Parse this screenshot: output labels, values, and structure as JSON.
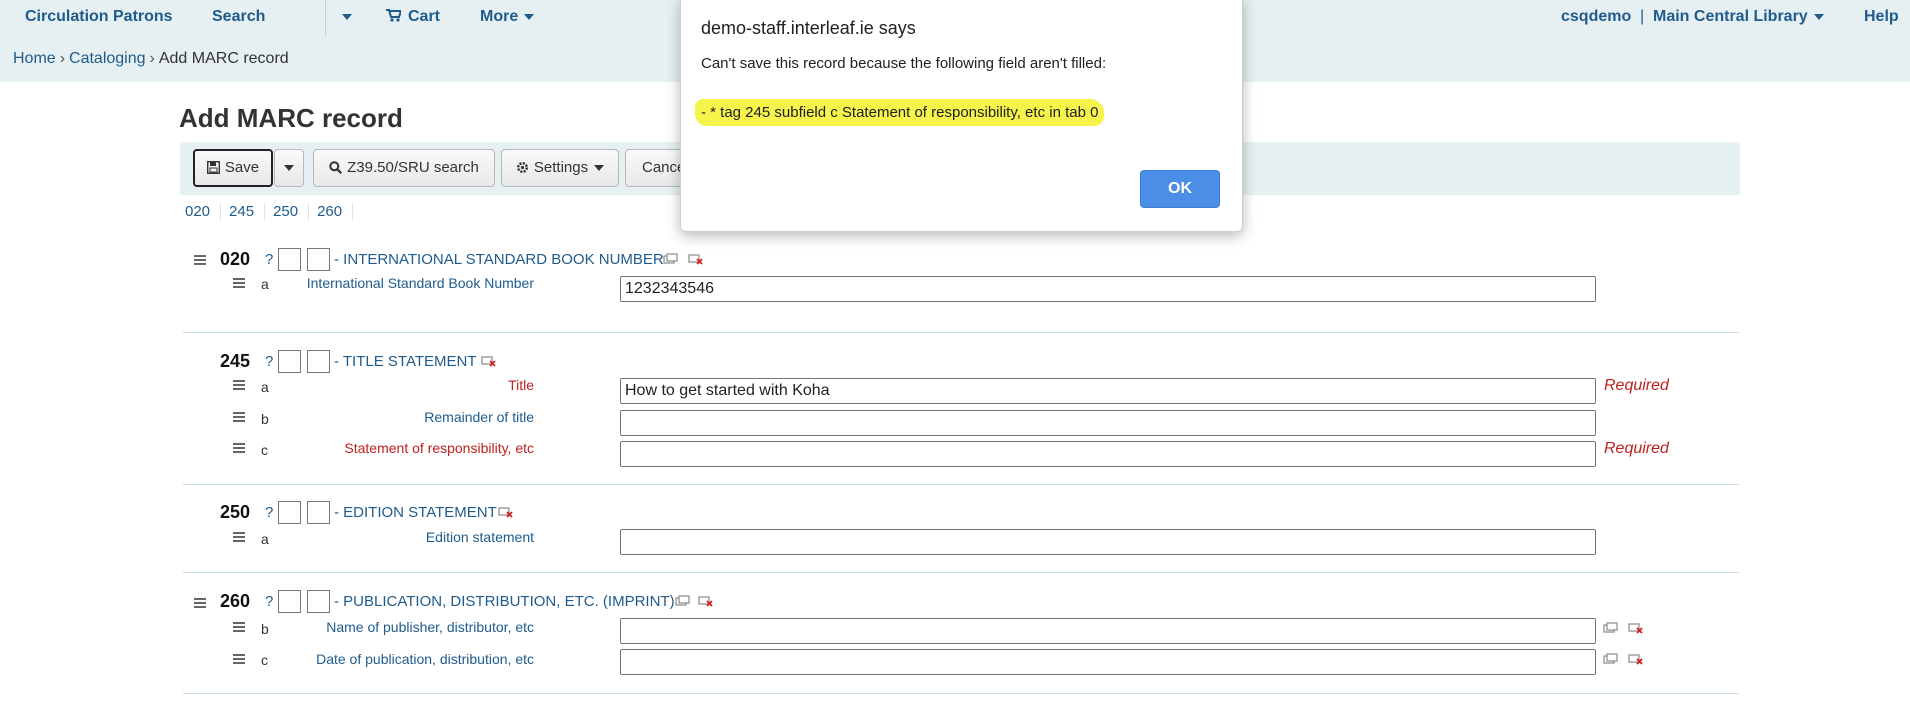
{
  "nav": {
    "circulation": "Circulation",
    "patrons": "Patrons",
    "search": "Search",
    "cart": "Cart",
    "more": "More",
    "user": "csqdemo",
    "separator": "|",
    "library": "Main Central Library",
    "help": "Help"
  },
  "breadcrumb": {
    "home": "Home",
    "cataloging": "Cataloging",
    "current": "Add MARC record",
    "separator": "›"
  },
  "page": {
    "title": "Add MARC record"
  },
  "toolbar": {
    "save": "Save",
    "z3950": "Z39.50/SRU search",
    "settings": "Settings",
    "cancel": "Cancel"
  },
  "tabs": [
    "020",
    "245",
    "250",
    "260"
  ],
  "fields": {
    "f020": {
      "tag": "020",
      "help": "?",
      "label": "- INTERNATIONAL STANDARD BOOK NUMBER",
      "subfields": [
        {
          "code": "a",
          "label": "International Standard Book Number",
          "value": "1232343546"
        }
      ]
    },
    "f245": {
      "tag": "245",
      "help": "?",
      "label": "- TITLE STATEMENT",
      "subfields": [
        {
          "code": "a",
          "label": "Title",
          "value": "How to get started with Koha",
          "required": "Required"
        },
        {
          "code": "b",
          "label": "Remainder of title",
          "value": ""
        },
        {
          "code": "c",
          "label": "Statement of responsibility, etc",
          "value": "",
          "required": "Required"
        }
      ]
    },
    "f250": {
      "tag": "250",
      "help": "?",
      "label": "- EDITION STATEMENT",
      "subfields": [
        {
          "code": "a",
          "label": "Edition statement",
          "value": ""
        }
      ]
    },
    "f260": {
      "tag": "260",
      "help": "?",
      "label": "- PUBLICATION, DISTRIBUTION, ETC. (IMPRINT)",
      "subfields": [
        {
          "code": "b",
          "label": "Name of publisher, distributor, etc",
          "value": ""
        },
        {
          "code": "c",
          "label": "Date of publication, distribution, etc",
          "value": ""
        }
      ]
    }
  },
  "dialog": {
    "title": "demo-staff.interleaf.ie says",
    "message": "Can't save this record because the following field aren't filled:",
    "error": "- * tag 245 subfield c Statement of responsibility, etc in tab 0",
    "ok": "OK"
  },
  "colors": {
    "link": "#1f5b8c",
    "required": "#c02020",
    "navbar_bg": "#e6f0f2",
    "highlight": "#f6f34a",
    "ok_button": "#4a8ee8"
  }
}
